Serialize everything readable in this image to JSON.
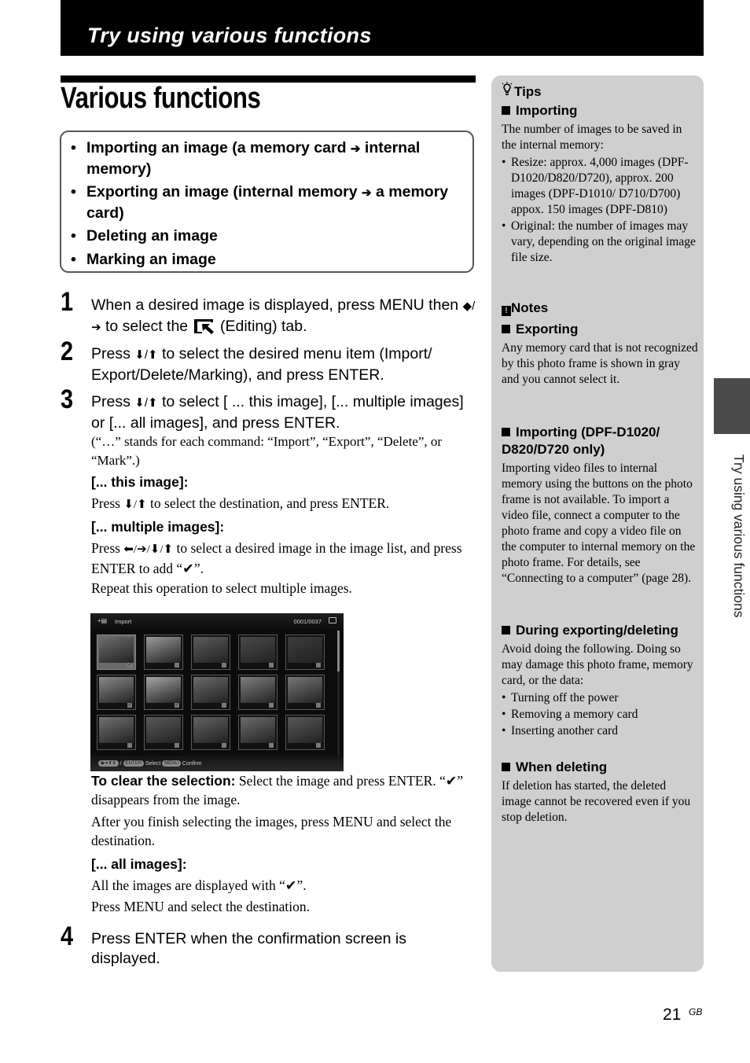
{
  "header": {
    "banner_title": "Try using various functions",
    "page_title": "Various functions"
  },
  "summary": {
    "items": [
      {
        "pre": "Importing an image (a memory card ",
        "arrow": "➔",
        "post": " internal memory)"
      },
      {
        "pre": "Exporting an image (internal memory ",
        "arrow": "➔",
        "post": " a memory card)"
      },
      {
        "pre": "Deleting an image",
        "arrow": "",
        "post": ""
      },
      {
        "pre": "Marking an image",
        "arrow": "",
        "post": ""
      }
    ]
  },
  "steps": {
    "s1": {
      "num": "1",
      "a": "When a desired image is displayed, press MENU then ",
      "arrows": "◆/➔",
      "b": " to select the ",
      "c": " (Editing) tab."
    },
    "s2": {
      "num": "2",
      "a": "Press ",
      "arrows": "⬇/⬆",
      "b": " to select the desired menu item (Import/ Export/Delete/Marking), and press ENTER."
    },
    "s3": {
      "num": "3",
      "a": "Press ",
      "arrows": "⬇/⬆",
      "b": " to select [ ... this image], [... multiple images] or [... all images], and press ENTER.",
      "note": "(“…” stands for each command: “Import”, “Export”, “Delete”, or “Mark”.)"
    },
    "this_image": {
      "heading": "[... this image]:",
      "a": "Press ",
      "arrows": "⬇/⬆",
      "b": " to select the destination, and press ENTER."
    },
    "multiple_images": {
      "heading": "[... multiple images]:",
      "a": "Press ",
      "arrows": "⬅/➔/⬇/⬆",
      "b": " to select a desired image in the image list, and press ENTER to add “✔”.",
      "repeat": "Repeat this operation to select multiple images."
    },
    "clear": {
      "label": "To clear the selection:",
      "text": " Select the image and press  ENTER. “✔” disappears from the image."
    },
    "after": "After you finish selecting the images, press MENU and select the destination.",
    "all_images": {
      "heading": "[... all images]:",
      "line1": "All the images are displayed with “✔”.",
      "line2": "Press MENU and select the destination."
    },
    "s4": {
      "num": "4",
      "text": "Press ENTER when the confirmation screen is displayed."
    }
  },
  "screen": {
    "title": "Import",
    "icon": "+▤",
    "counter": "0001/0037",
    "thumbnails": [
      {
        "selected": true,
        "checked": true
      },
      {
        "selected": false,
        "checked": false
      },
      {
        "selected": false,
        "checked": false
      },
      {
        "selected": false,
        "checked": false
      },
      {
        "selected": false,
        "checked": false
      },
      {
        "selected": false,
        "checked": true
      },
      {
        "selected": false,
        "checked": true
      },
      {
        "selected": false,
        "checked": false
      },
      {
        "selected": false,
        "checked": false
      },
      {
        "selected": false,
        "checked": false
      },
      {
        "selected": false,
        "checked": false
      },
      {
        "selected": false,
        "checked": false
      },
      {
        "selected": false,
        "checked": false
      },
      {
        "selected": false,
        "checked": false
      },
      {
        "selected": false,
        "checked": false
      }
    ],
    "footer": {
      "nav_pill": "◆➔⬆⬇",
      "sep": "/",
      "enter_pill": "ENTER",
      "select_label": "Select",
      "menu_pill": "MENU",
      "confirm_label": "Confirm"
    }
  },
  "sidebar": {
    "tips_title": "Tips",
    "tips_importing": {
      "heading": "Importing",
      "intro": "The number of images to be saved in the internal memory:",
      "bullets": [
        "Resize: approx. 4,000 images (DPF-D1020/D820/D720), approx. 200 images (DPF-D1010/ D710/D700) appox. 150 images (DPF-D810)",
        "Original: the number of images may vary, depending on the original image file size."
      ]
    },
    "notes_title": "Notes",
    "exporting": {
      "heading": "Exporting",
      "text": "Any memory card that is not recognized by this photo frame is shown in gray and you cannot select it."
    },
    "importing_video": {
      "heading": "Importing (DPF-D1020/ D820/D720 only)",
      "text": "Importing video files to internal memory using the buttons on the photo frame is not available. To import a video file, connect a computer to the photo frame and copy a video file on the computer to internal memory on the photo frame. For details, see “Connecting to a computer” (page 28)."
    },
    "during": {
      "heading": "During exporting/deleting",
      "intro": "Avoid doing the following. Doing so may damage this photo frame, memory card, or the data:",
      "bullets": [
        "Turning off the power",
        "Removing a memory card",
        "Inserting another card"
      ]
    },
    "deleting": {
      "heading": "When deleting",
      "text": "If deletion has started, the deleted image cannot be recovered even if you stop deletion."
    }
  },
  "side_tab_label": "Try using various functions",
  "footer": {
    "page_number": "21",
    "region": "GB"
  }
}
